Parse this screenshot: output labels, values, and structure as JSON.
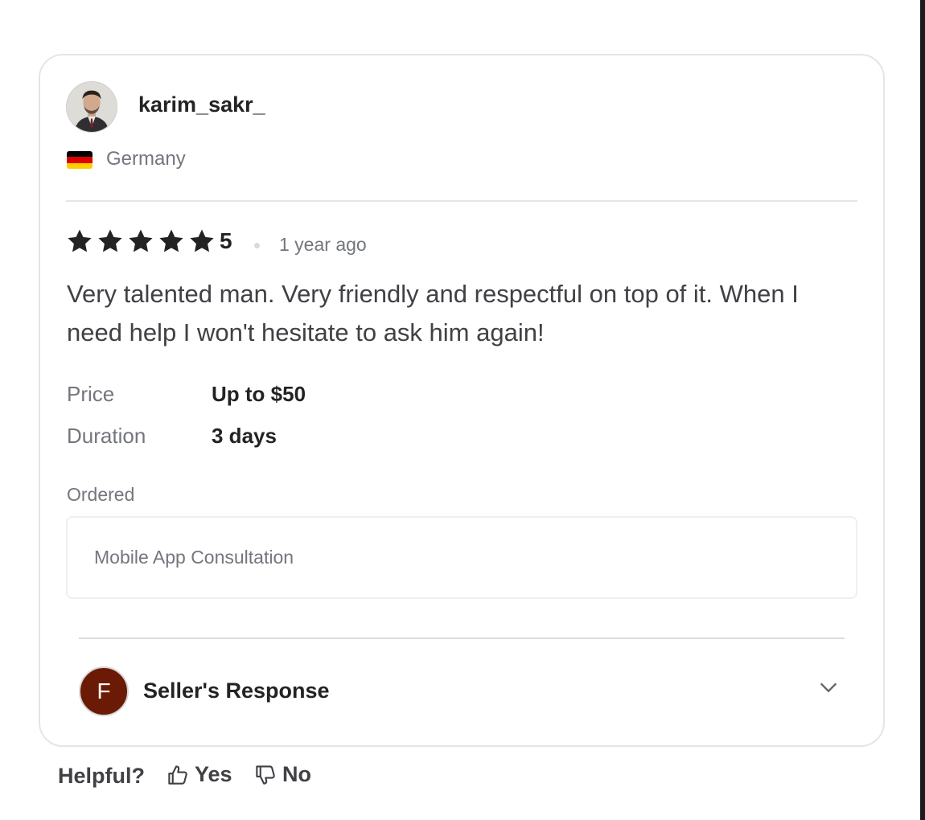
{
  "review": {
    "username": "karim_sakr_",
    "country": "Germany",
    "flag_colors": [
      "#000000",
      "#DD0000",
      "#FFCE00"
    ],
    "rating": "5",
    "star_count": 5,
    "time_ago": "1 year ago",
    "text": "Very talented man. Very friendly and respectful on top of it. When I need help I won't hesitate to ask him again!",
    "price_label": "Price",
    "price_value": "Up to $50",
    "duration_label": "Duration",
    "duration_value": "3 days",
    "ordered_label": "Ordered",
    "ordered_item": "Mobile App Consultation"
  },
  "seller": {
    "avatar_letter": "F",
    "avatar_color": "#6b1b05",
    "response_label": "Seller's Response",
    "expand_icon": "chevron-down-icon"
  },
  "helpful": {
    "question": "Helpful?",
    "yes_label": "Yes",
    "no_label": "No",
    "yes_icon": "thumbs-up-icon",
    "no_icon": "thumbs-down-icon"
  },
  "colors": {
    "primary_text": "#222325",
    "secondary_text": "#74767e",
    "border": "#e4e5e7"
  }
}
